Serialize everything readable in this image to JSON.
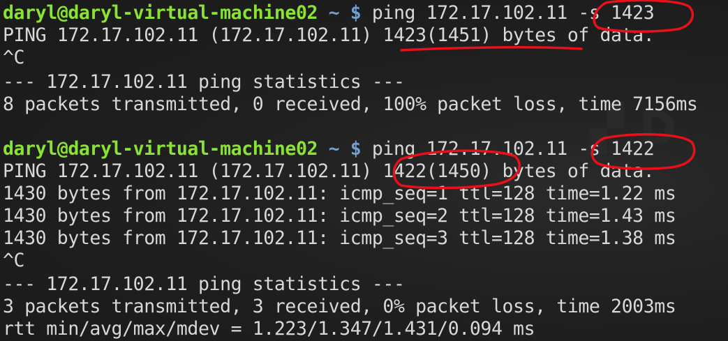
{
  "window": {
    "background_color": "#1d1d1d",
    "prompt_user_color": "#8ae234",
    "prompt_symbol_color": "#729fcf",
    "annotation_color": "#e8101a"
  },
  "block1": {
    "prompt_user": "daryl@daryl-virtual-machine02",
    "prompt_sym": " ~ $",
    "command": " ping 172.17.102.11 -s 1423",
    "ping_header": "PING 172.17.102.11 (172.17.102.11) 1423(1451) bytes of data.",
    "interrupt": "^C",
    "stats_title": "--- 172.17.102.11 ping statistics ---",
    "stats_summary": "8 packets transmitted, 0 received, 100% packet loss, time 7156ms"
  },
  "block2": {
    "prompt_user": "daryl@daryl-virtual-machine02",
    "prompt_sym": " ~ $",
    "command": " ping 172.17.102.11 -s 1422",
    "ping_header": "PING 172.17.102.11 (172.17.102.11) 1422(1450) bytes of data.",
    "replies": [
      "1430 bytes from 172.17.102.11: icmp_seq=1 ttl=128 time=1.22 ms",
      "1430 bytes from 172.17.102.11: icmp_seq=2 ttl=128 time=1.43 ms",
      "1430 bytes from 172.17.102.11: icmp_seq=3 ttl=128 time=1.38 ms"
    ],
    "interrupt": "^C",
    "stats_title": "--- 172.17.102.11 ping statistics ---",
    "stats_summary": "3 packets transmitted, 3 received, 0% packet loss, time 2003ms",
    "rtt": "rtt min/avg/max/mdev = 1.223/1.347/1.431/0.094 ms"
  }
}
